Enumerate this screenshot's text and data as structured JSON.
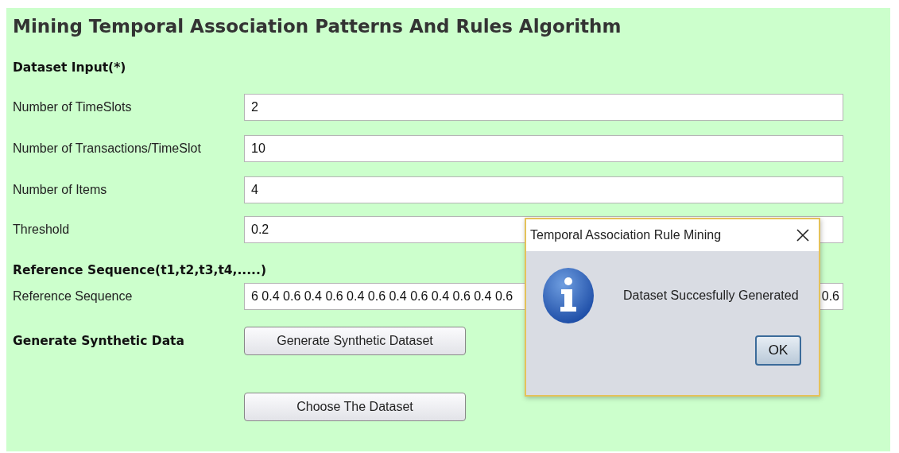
{
  "title": "Mining Temporal Association Patterns And Rules Algorithm",
  "dataset_section": {
    "heading": "Dataset Input(*)",
    "fields": [
      {
        "label": "Number of TimeSlots",
        "value": "2"
      },
      {
        "label": "Number of Transactions/TimeSlot",
        "value": "10"
      },
      {
        "label": "Number of Items",
        "value": "4"
      },
      {
        "label": "Threshold",
        "value": "0.2"
      }
    ]
  },
  "reference_section": {
    "heading": "Reference Sequence(t1,t2,t3,t4,.....)",
    "label": "Reference Sequence",
    "value": "6 0.4 0.6 0.4 0.6 0.4 0.6 0.4 0.6 0.4 0.6 0.4 0.6",
    "value_tail": "0.6"
  },
  "generate_section": {
    "heading": "Generate Synthetic Data",
    "buttons": [
      "Generate Synthetic Dataset",
      "Choose The Dataset"
    ]
  },
  "dialog": {
    "title": "Temporal Association Rule Mining",
    "message": "Dataset Succesfully Generated",
    "button": "OK"
  }
}
